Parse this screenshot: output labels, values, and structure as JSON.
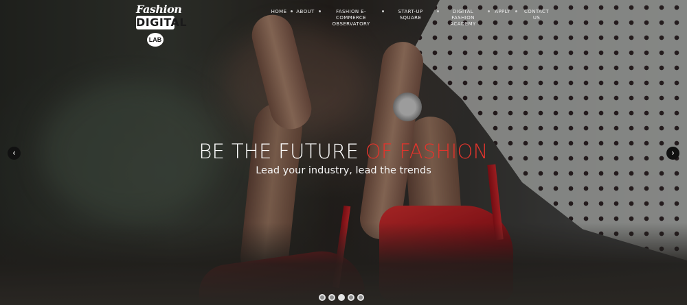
{
  "logo": {
    "line1": "Fashion",
    "line2": "DIGITAL",
    "line3": "LAB"
  },
  "nav": {
    "items": [
      {
        "label": "HOME"
      },
      {
        "label": "ABOUT"
      },
      {
        "label": "FASHION E-COMMERCE\nOBSERVATORY"
      },
      {
        "label": "START-UP SQUARE"
      },
      {
        "label": "DIGITAL FASHION\nACADEMY"
      },
      {
        "label": "APPLY"
      },
      {
        "label": "CONTACT US"
      }
    ]
  },
  "hero": {
    "headline_part1": "BE THE FUTURE ",
    "headline_part2": "OF FASHION",
    "subline": "Lead your industry, lead the trends",
    "accent_color": "#e2342c",
    "prev_icon": "chevron-left-icon",
    "next_icon": "chevron-right-icon",
    "slide_count": 5,
    "active_slide": 3
  }
}
